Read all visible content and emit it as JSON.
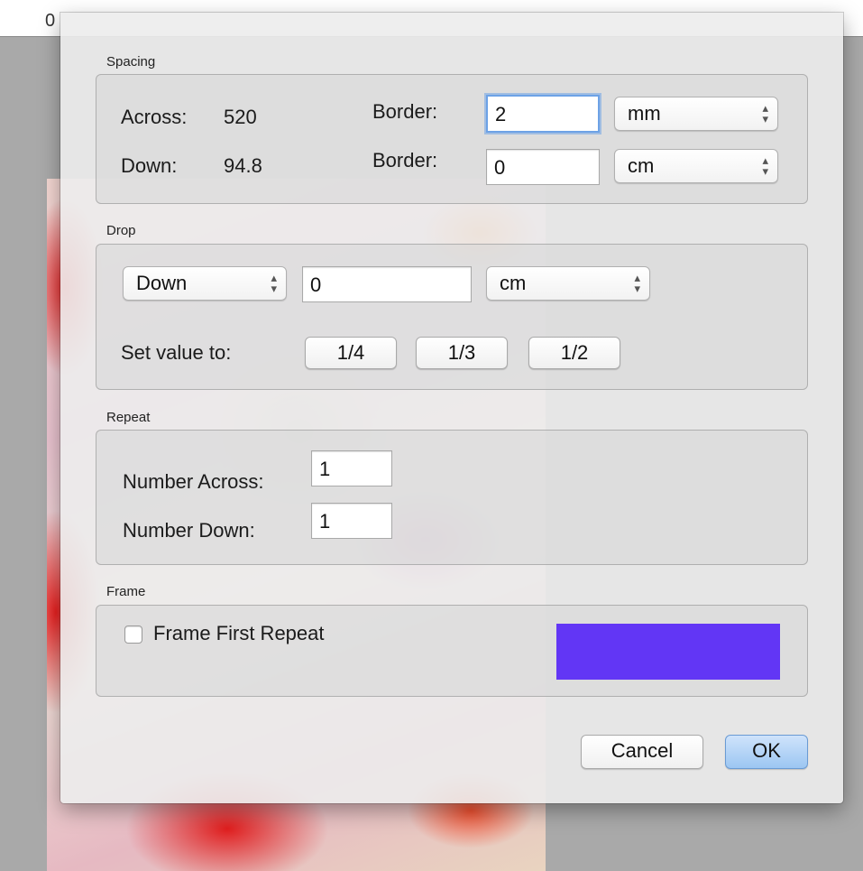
{
  "background": {
    "ruler_mark": "0"
  },
  "dialog": {
    "spacing": {
      "title": "Spacing",
      "across_label": "Across:",
      "across_value": "520",
      "down_label": "Down:",
      "down_value": "94.8",
      "border1_label": "Border:",
      "border1_value": "2",
      "border1_unit": "mm",
      "border2_label": "Border:",
      "border2_value": "0",
      "border2_unit": "cm"
    },
    "drop": {
      "title": "Drop",
      "direction": "Down",
      "value": "0",
      "unit": "cm",
      "set_value_label": "Set value to:",
      "quarter_label": "1/4",
      "third_label": "1/3",
      "half_label": "1/2"
    },
    "repeat": {
      "title": "Repeat",
      "across_label": "Number Across:",
      "across_value": "1",
      "down_label": "Number Down:",
      "down_value": "1"
    },
    "frame": {
      "title": "Frame",
      "checkbox_label": "Frame First Repeat",
      "checked": false,
      "color": "#6236f5"
    },
    "buttons": {
      "cancel_label": "Cancel",
      "ok_label": "OK"
    }
  }
}
